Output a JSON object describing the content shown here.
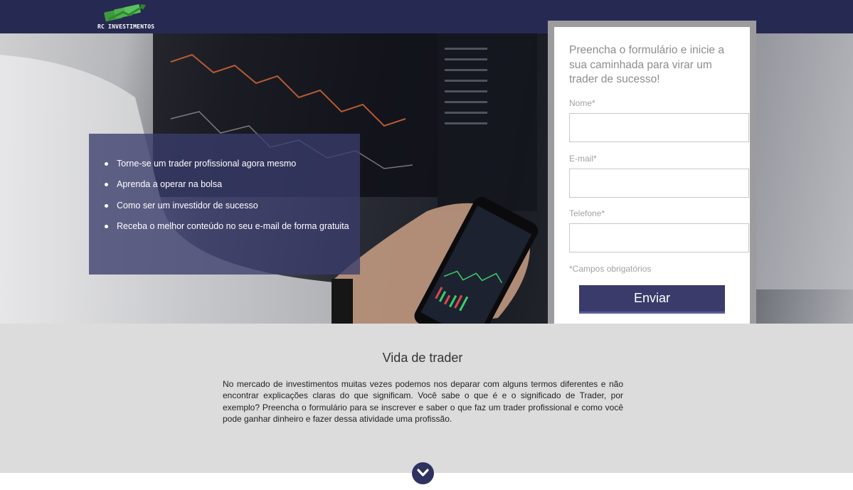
{
  "brand": {
    "name": "RC INVESTIMENTOS",
    "logo_icon": "money-arrow-icon"
  },
  "benefits": [
    "Torne-se um trader profissional agora mesmo",
    "Aprenda a operar na bolsa",
    "Como ser um investidor de sucesso",
    "Receba o melhor conteúdo no seu e-mail de forma gratuita"
  ],
  "form": {
    "title": "Preencha o formulário e inicie a sua caminhada para virar um trader de sucesso!",
    "fields": [
      {
        "label": "Nome*",
        "value": ""
      },
      {
        "label": "E-mail*",
        "value": ""
      },
      {
        "label": "Telefone*",
        "value": ""
      }
    ],
    "required_note": "*Campos obrigatórios",
    "submit_label": "Enviar"
  },
  "section": {
    "title": "Vida de trader",
    "text": "No mercado de investimentos muitas vezes podemos nos deparar com alguns termos diferentes e não encontrar explicações claras do que significam. Você sabe o que é e o significado de Trader, por exemplo? Preencha o formulário para se inscrever e saber o que faz um trader profissional e como você pode ganhar dinheiro e fazer dessa atividade uma profissão."
  },
  "scroll_icon": "chevron-down-icon",
  "colors": {
    "header": "#262a52",
    "accent": "#3a3b6b",
    "section_bg": "#dcdcdc"
  }
}
